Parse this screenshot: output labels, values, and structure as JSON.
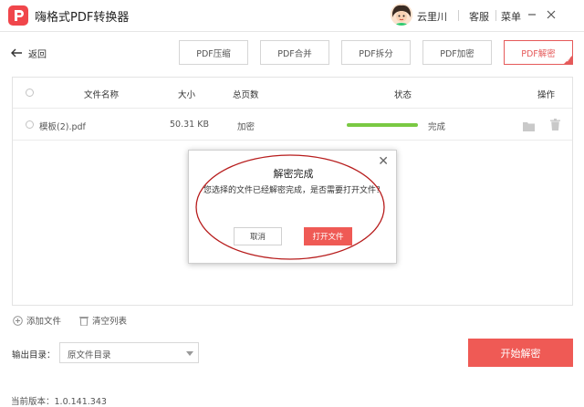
{
  "app": {
    "title": "嗨格式PDF转换器"
  },
  "user": {
    "name": "云里川"
  },
  "topmenu": {
    "service": "客服",
    "menu": "菜单"
  },
  "nav": {
    "back_label": "返回"
  },
  "toolbar": {
    "buttons": [
      {
        "label": "PDF压缩",
        "active": false
      },
      {
        "label": "PDF合并",
        "active": false
      },
      {
        "label": "PDF拆分",
        "active": false
      },
      {
        "label": "PDF加密",
        "active": false
      },
      {
        "label": "PDF解密",
        "active": true
      }
    ]
  },
  "table": {
    "headers": {
      "name": "文件名称",
      "size": "大小",
      "pages": "总页数",
      "status": "状态",
      "actions": "操作"
    },
    "rows": [
      {
        "name": "模板(2).pdf",
        "size": "50.31 KB",
        "pages": "加密",
        "progress": 1.0,
        "status": "完成"
      }
    ]
  },
  "dialog": {
    "title": "解密完成",
    "message": "您选择的文件已经解密完成，是否需要打开文件？",
    "cancel_label": "取消",
    "open_label": "打开文件"
  },
  "bottom": {
    "add_files": "添加文件",
    "clear_list": "清空列表",
    "output_label": "输出目录：",
    "output_value": "原文件目录",
    "start_label": "开始解密"
  },
  "footer": {
    "version": "当前版本：1.0.141.343"
  },
  "colors": {
    "accent": "#ef5a55",
    "progress": "#7ac943",
    "annotation": "#b71c1c"
  }
}
